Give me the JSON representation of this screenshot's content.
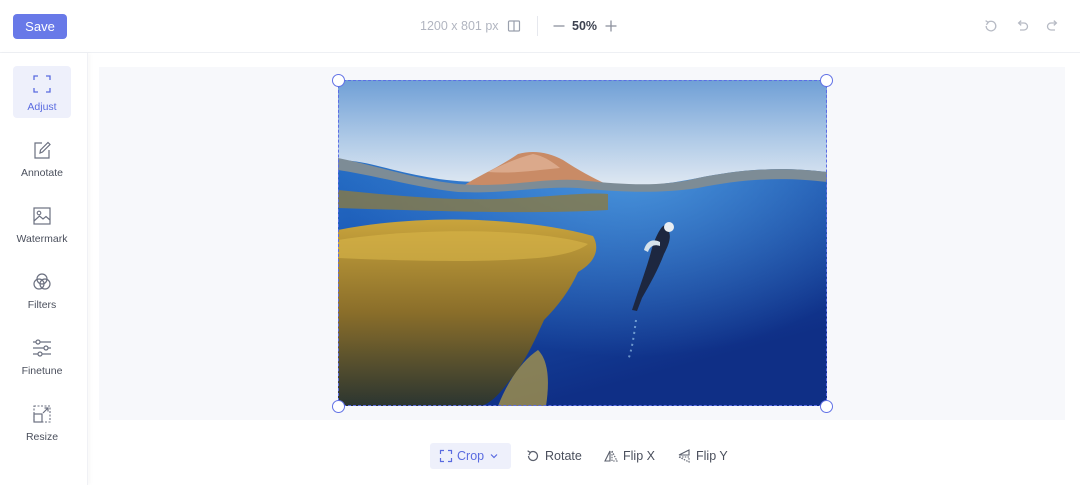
{
  "toolbar": {
    "save_label": "Save",
    "image_dimensions": "1200 x 801 px",
    "zoom_level": "50%",
    "icons": {
      "compare": "compare-icon",
      "zoom_out": "minus-icon",
      "zoom_in": "plus-icon",
      "reset": "reset-icon",
      "undo": "undo-icon",
      "redo": "redo-icon"
    }
  },
  "sidebar": {
    "items": [
      {
        "label": "Adjust",
        "icon": "crop-corners-icon",
        "active": true
      },
      {
        "label": "Annotate",
        "icon": "pencil-icon",
        "active": false
      },
      {
        "label": "Watermark",
        "icon": "image-icon",
        "active": false
      },
      {
        "label": "Filters",
        "icon": "filters-circles-icon",
        "active": false
      },
      {
        "label": "Finetune",
        "icon": "sliders-icon",
        "active": false
      },
      {
        "label": "Resize",
        "icon": "resize-icon",
        "active": false
      }
    ]
  },
  "adjust_tools": {
    "crop_label": "Crop",
    "rotate_label": "Rotate",
    "flip_x_label": "Flip X",
    "flip_y_label": "Flip Y"
  },
  "colors": {
    "accent": "#6879e8",
    "active_bg": "#eef0fb",
    "canvas_bg": "#f7f8fb"
  }
}
